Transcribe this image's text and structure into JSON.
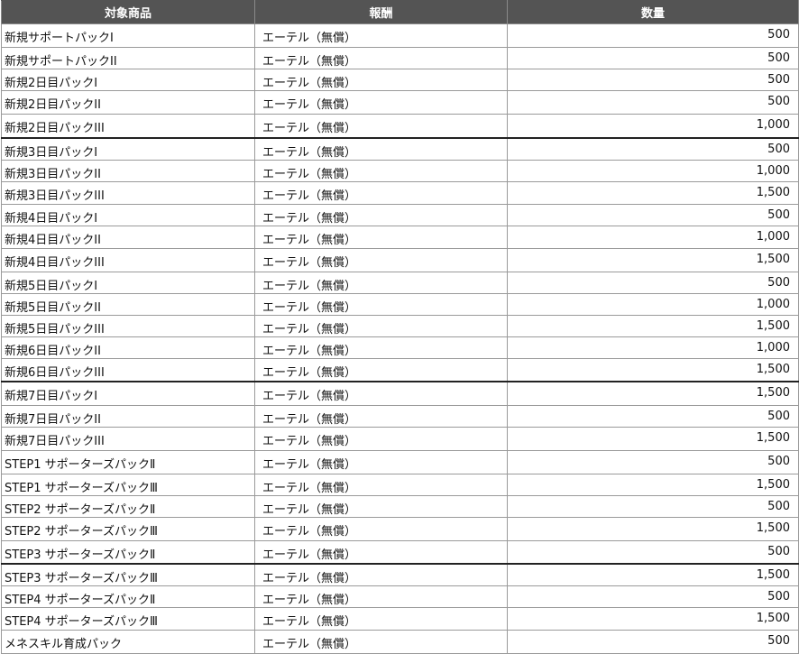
{
  "table": {
    "headers": [
      "対象商品",
      "報酬",
      "数量"
    ],
    "rows": [
      {
        "item": "新規サポートパックI",
        "reward": "エーテル（無償）",
        "qty": "500"
      },
      {
        "item": "新規サポートパックII",
        "reward": "エーテル（無償）",
        "qty": "500"
      },
      {
        "item": "新規2日目パックI",
        "reward": "エーテル（無償）",
        "qty": "500"
      },
      {
        "item": "新規2日目パックII",
        "reward": "エーテル（無償）",
        "qty": "500"
      },
      {
        "item": "新規2日目パックIII",
        "reward": "エーテル（無償）",
        "qty": "1,000"
      },
      {
        "item": "新規3日目パックI",
        "reward": "エーテル（無償）",
        "qty": "500"
      },
      {
        "item": "新規3日目パックII",
        "reward": "エーテル（無償）",
        "qty": "1,000"
      },
      {
        "item": "新規3日目パックIII",
        "reward": "エーテル（無償）",
        "qty": "1,500"
      },
      {
        "item": "新規4日目パックI",
        "reward": "エーテル（無償）",
        "qty": "500"
      },
      {
        "item": "新規4日目パックII",
        "reward": "エーテル（無償）",
        "qty": "1,000"
      },
      {
        "item": "新規4日目パックIII",
        "reward": "エーテル（無償）",
        "qty": "1,500"
      },
      {
        "item": "新規5日目パックI",
        "reward": "エーテル（無償）",
        "qty": "500"
      },
      {
        "item": "新規5日目パックII",
        "reward": "エーテル（無償）",
        "qty": "1,000"
      },
      {
        "item": "新規5日目パックIII",
        "reward": "エーテル（無償）",
        "qty": "1,500"
      },
      {
        "item": "新規6日目パックII",
        "reward": "エーテル（無償）",
        "qty": "1,000"
      },
      {
        "item": "新規6日目パックIII",
        "reward": "エーテル（無償）",
        "qty": "1,500"
      },
      {
        "item": "新規7日目パックI",
        "reward": "エーテル（無償）",
        "qty": "1,500"
      },
      {
        "item": "新規7日目パックII",
        "reward": "エーテル（無償）",
        "qty": "500"
      },
      {
        "item": "新規7日目パックIII",
        "reward": "エーテル（無償）",
        "qty": "1,500"
      },
      {
        "item": "STEP1 サポーターズパックⅡ",
        "reward": "エーテル（無償）",
        "qty": "500"
      },
      {
        "item": "STEP1 サポーターズパックⅢ",
        "reward": "エーテル（無償）",
        "qty": "1,500"
      },
      {
        "item": "STEP2 サポーターズパックⅡ",
        "reward": "エーテル（無償）",
        "qty": "500"
      },
      {
        "item": "STEP2 サポーターズパックⅢ",
        "reward": "エーテル（無償）",
        "qty": "1,500"
      },
      {
        "item": "STEP3 サポーターズパックⅡ",
        "reward": "エーテル（無償）",
        "qty": "500"
      },
      {
        "item": "STEP3 サポーターズパックⅢ",
        "reward": "エーテル（無償）",
        "qty": "1,500"
      },
      {
        "item": "STEP4 サポーターズパックⅡ",
        "reward": "エーテル（無償）",
        "qty": "500"
      },
      {
        "item": "STEP4 サポーターズパックⅢ",
        "reward": "エーテル（無償）",
        "qty": "1,500"
      },
      {
        "item": "メネスキル育成パック",
        "reward": "エーテル（無償）",
        "qty": "500"
      }
    ]
  }
}
